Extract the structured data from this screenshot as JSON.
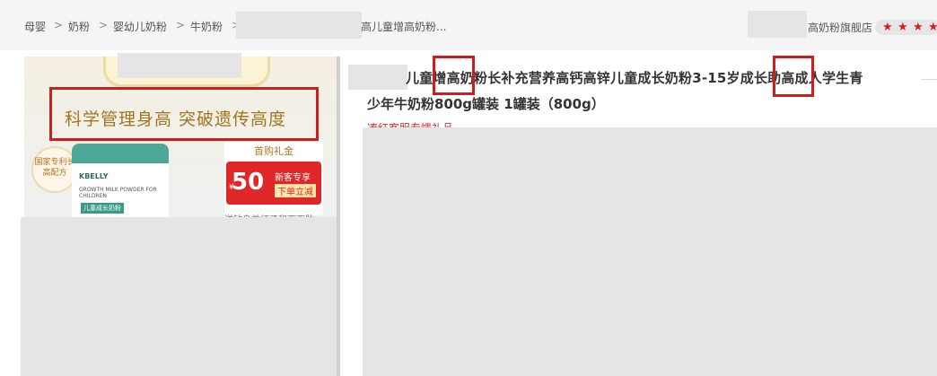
{
  "breadcrumb": {
    "items": [
      "母婴",
      "奶粉",
      "婴幼儿奶粉",
      "牛奶粉"
    ],
    "separator": ">",
    "current": "高儿童增高奶粉..."
  },
  "store": {
    "name": "高奶粉旗舰店",
    "rating_stars": 4
  },
  "product_image": {
    "slogan": "科学管理身高 突破遗传高度",
    "badge": "国家专利长高配方",
    "can_brand": "KBELLY",
    "can_line1": "GROWTH MILK POWDER FOR CHILDREN",
    "can_line2": "儿童成长奶粉",
    "gift_title": "首购礼金",
    "coupon_currency": "¥",
    "coupon_amount": "50",
    "coupon_label1": "新客专享",
    "coupon_label2": "下单立减",
    "gift_note": "送钻身单红子和下下肋"
  },
  "product": {
    "title_line1": "儿童增高奶粉长补充营养高钙高锌儿童成长奶粉3-15岁成长助高成人学生青",
    "title_line2": "少年牛奶粉800g罐装 1罐装（800g）",
    "promo_text": "凑红客服专馈礼品"
  },
  "colors": {
    "accent_red": "#c81f1f",
    "star_red": "#d0201c",
    "redacted_grey": "#e5e5e5"
  }
}
